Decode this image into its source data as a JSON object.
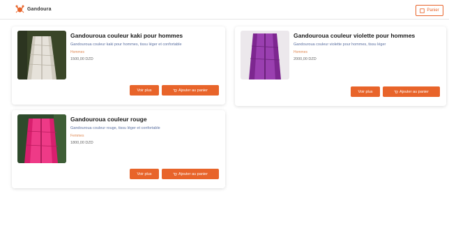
{
  "header": {
    "brand": "Gandoura",
    "logo_icon": "crab-logo-icon",
    "cart_button": "Panier",
    "accent": "#e8642a"
  },
  "products": [
    {
      "title": "Gandouroua couleur kaki pour hommes",
      "description": "Gandouroua couleur kaki pour hommes, tissu léger et confortable",
      "meta": "Hommes",
      "price": "1500,00 DZD",
      "view_label": "Voir plus",
      "cart_label": "Ajouter au panier",
      "thumb_colors": [
        "#2f3a22",
        "#c9c4b8"
      ]
    },
    {
      "title": "Gandouroua couleur violette pour hommes",
      "description": "Gandouroua couleur violette pour hommes, tissu léger",
      "meta": "Hommes",
      "price": "2000,00 DZD",
      "view_label": "Voir plus",
      "cart_label": "Ajouter au panier",
      "thumb_colors": [
        "#e9e4e8",
        "#8a2c9b"
      ]
    },
    {
      "title": "Gandouroua couleur rouge",
      "description": "Gandouroua couleur rouge, tissu léger et confortable",
      "meta": "Femmes",
      "price": "1800,00 DZD",
      "view_label": "Voir plus",
      "cart_label": "Ajouter au panier",
      "thumb_colors": [
        "#2a4a2a",
        "#e02a78"
      ]
    }
  ]
}
